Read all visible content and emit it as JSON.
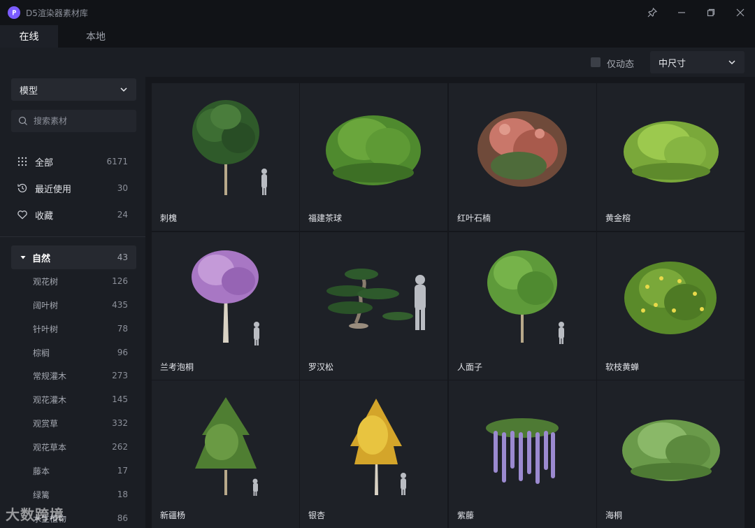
{
  "window": {
    "title": "D5渲染器素材库"
  },
  "tabs": [
    {
      "label": "在线"
    },
    {
      "label": "本地"
    }
  ],
  "toolbar": {
    "dynamic_only_label": "仅动态",
    "size_value": "中尺寸"
  },
  "sidebar": {
    "type_value": "模型",
    "search_placeholder": "搜索素材",
    "nav": [
      {
        "label": "全部",
        "count": "6171",
        "icon": "grid-dots-icon"
      },
      {
        "label": "最近使用",
        "count": "30",
        "icon": "history-icon"
      },
      {
        "label": "收藏",
        "count": "24",
        "icon": "heart-icon"
      }
    ],
    "category": {
      "label": "自然",
      "count": "43"
    },
    "subcategories": [
      {
        "label": "观花树",
        "count": "126"
      },
      {
        "label": "阔叶树",
        "count": "435"
      },
      {
        "label": "针叶树",
        "count": "78"
      },
      {
        "label": "棕榈",
        "count": "96"
      },
      {
        "label": "常规灌木",
        "count": "273"
      },
      {
        "label": "观花灌木",
        "count": "145"
      },
      {
        "label": "观赏草",
        "count": "332"
      },
      {
        "label": "观花草本",
        "count": "262"
      },
      {
        "label": "藤本",
        "count": "17"
      },
      {
        "label": "绿篱",
        "count": "18"
      },
      {
        "label": "水生植物",
        "count": "86"
      }
    ]
  },
  "assets": [
    {
      "name": "刺槐"
    },
    {
      "name": "福建茶球"
    },
    {
      "name": "红叶石楠"
    },
    {
      "name": "黄金榕"
    },
    {
      "name": "兰考泡桐"
    },
    {
      "name": "罗汉松"
    },
    {
      "name": "人面子"
    },
    {
      "name": "软枝黄蝉"
    },
    {
      "name": "新疆杨"
    },
    {
      "name": "银杏"
    },
    {
      "name": "紫藤"
    },
    {
      "name": "海桐"
    }
  ],
  "watermark": "大数跨境",
  "colors": {
    "accent": "#7b5cff",
    "background": "#15171c",
    "panel": "#1b1e24",
    "card": "#1e2127"
  }
}
